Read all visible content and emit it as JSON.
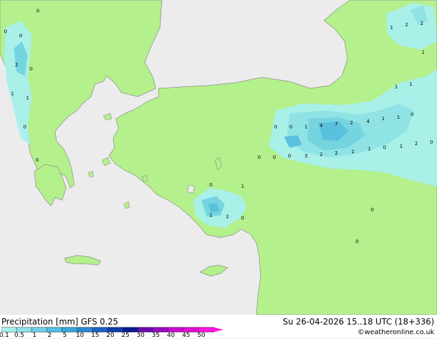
{
  "map": {
    "value_labels": [
      {
        "text": "0",
        "lon_lat": "n-greece"
      },
      {
        "text": "0",
        "lon_lat": "adriatic-1"
      },
      {
        "text": "0",
        "lon_lat": "adriatic-2"
      },
      {
        "text": "2",
        "lon_lat": "albania"
      },
      {
        "text": "0",
        "lon_lat": "albania-2"
      },
      {
        "text": "1",
        "lon_lat": "ionian-1"
      },
      {
        "text": "1",
        "lon_lat": "ionian-2"
      },
      {
        "text": "0",
        "lon_lat": "ionian-3"
      },
      {
        "text": "0",
        "lon_lat": "peloponnese"
      },
      {
        "text": "1",
        "lon_lat": "caucasus-1"
      },
      {
        "text": "2",
        "lon_lat": "caucasus-2"
      },
      {
        "text": "2",
        "lon_lat": "caucasus-3"
      },
      {
        "text": "1",
        "lon_lat": "caucasus-4"
      },
      {
        "text": "1",
        "lon_lat": "ne-turkey-1"
      },
      {
        "text": "1",
        "lon_lat": "ne-turkey-2"
      },
      {
        "text": "0",
        "lon_lat": "central-1"
      },
      {
        "text": "0",
        "lon_lat": "central-2"
      },
      {
        "text": "1",
        "lon_lat": "central-3"
      },
      {
        "text": "4",
        "lon_lat": "central-4"
      },
      {
        "text": "7",
        "lon_lat": "central-5"
      },
      {
        "text": "2",
        "lon_lat": "central-6"
      },
      {
        "text": "4",
        "lon_lat": "central-7"
      },
      {
        "text": "1",
        "lon_lat": "central-8"
      },
      {
        "text": "1",
        "lon_lat": "central-9"
      },
      {
        "text": "0",
        "lon_lat": "central-10"
      },
      {
        "text": "0",
        "lon_lat": "south-1"
      },
      {
        "text": "0",
        "lon_lat": "south-2"
      },
      {
        "text": "0",
        "lon_lat": "south-3"
      },
      {
        "text": "3",
        "lon_lat": "south-4"
      },
      {
        "text": "2",
        "lon_lat": "south-5"
      },
      {
        "text": "2",
        "lon_lat": "south-6"
      },
      {
        "text": "1",
        "lon_lat": "south-7"
      },
      {
        "text": "1",
        "lon_lat": "south-8"
      },
      {
        "text": "0",
        "lon_lat": "east-1"
      },
      {
        "text": "1",
        "lon_lat": "east-2"
      },
      {
        "text": "2",
        "lon_lat": "east-3"
      },
      {
        "text": "0",
        "lon_lat": "east-4"
      },
      {
        "text": "0",
        "lon_lat": "antalya-1"
      },
      {
        "text": "1",
        "lon_lat": "antalya-2"
      },
      {
        "text": "1",
        "lon_lat": "antalya-3"
      },
      {
        "text": "2",
        "lon_lat": "antalya-4"
      },
      {
        "text": "0",
        "lon_lat": "antalya-5"
      },
      {
        "text": "0",
        "lon_lat": "syria-1"
      },
      {
        "text": "0",
        "lon_lat": "syria-2"
      }
    ]
  },
  "footer": {
    "title": "Precipitation [mm]  GFS 0.25",
    "datetime": "Su 26-04-2026 15..18 UTC (18+336)",
    "credit": "©weatheronline.co.uk"
  },
  "legend": {
    "ticks": [
      "0.1",
      "0.5",
      "1",
      "2",
      "5",
      "10",
      "15",
      "20",
      "25",
      "30",
      "35",
      "40",
      "45",
      "50"
    ],
    "colors": [
      "#a8f0f0",
      "#8ce2ec",
      "#70d2e8",
      "#52bee4",
      "#3aa6dc",
      "#2a88d2",
      "#1a62c4",
      "#0e3cb0",
      "#0a1894",
      "#6a0ab0",
      "#9a0ac0",
      "#c80ad0",
      "#e60ad8",
      "#ff14e0"
    ],
    "land_color": "#b4f08c",
    "sea_color": "#ececec"
  }
}
